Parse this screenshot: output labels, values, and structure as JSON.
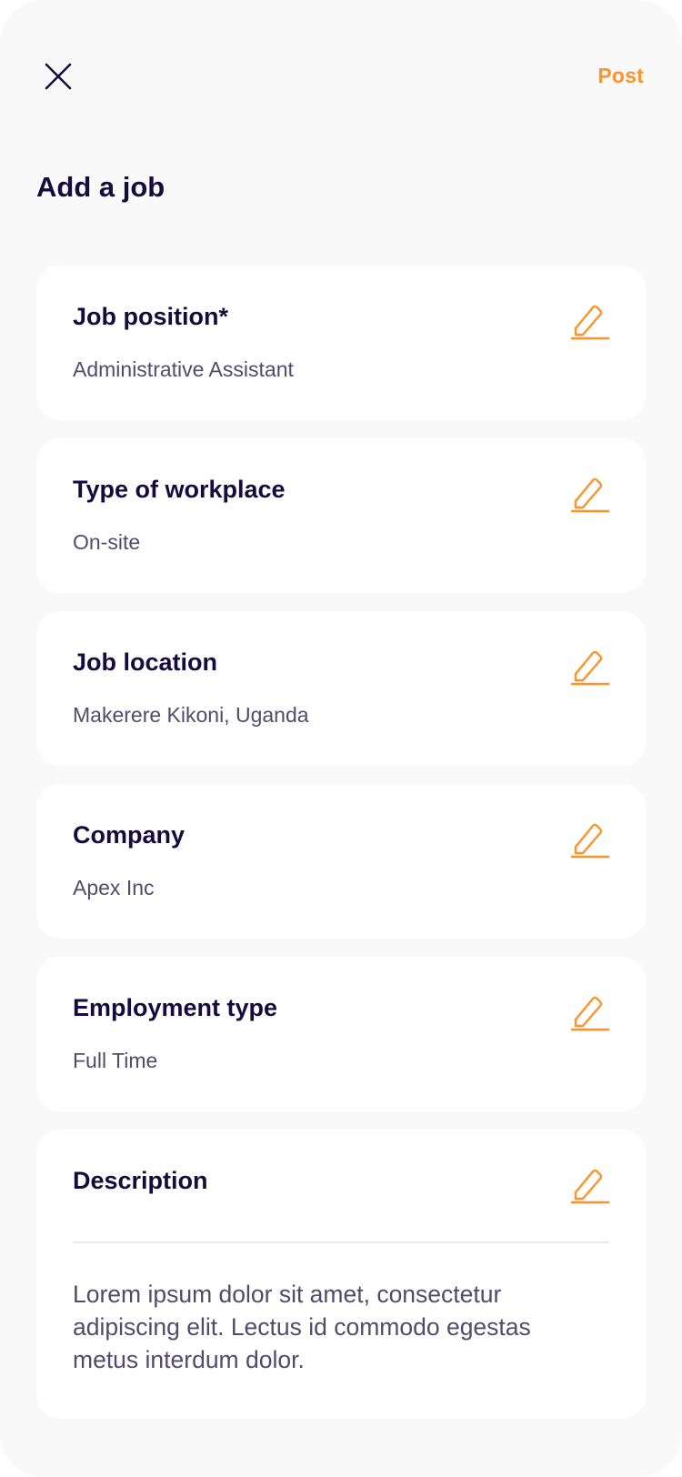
{
  "header": {
    "post_label": "Post",
    "close_icon": "close-icon",
    "accent_color": "#ff9228"
  },
  "page": {
    "title": "Add a job"
  },
  "fields": [
    {
      "label": "Job position*",
      "value": "Administrative Assistant",
      "edit_icon": "pencil-icon"
    },
    {
      "label": "Type of workplace",
      "value": "On-site",
      "edit_icon": "pencil-icon"
    },
    {
      "label": "Job location",
      "value": "Makerere Kikoni, Uganda",
      "edit_icon": "pencil-icon"
    },
    {
      "label": "Company",
      "value": "Apex Inc",
      "edit_icon": "pencil-icon"
    },
    {
      "label": "Employment type",
      "value": "Full Time",
      "edit_icon": "pencil-icon"
    }
  ],
  "description": {
    "label": "Description",
    "text": "Lorem ipsum dolor sit amet, consectetur adipiscing elit. Lectus id commodo egestas metus interdum dolor.",
    "edit_icon": "pencil-icon"
  },
  "colors": {
    "title": "#150b3d",
    "body": "#524b6b",
    "background": "#f9f9f9",
    "card": "#ffffff"
  }
}
